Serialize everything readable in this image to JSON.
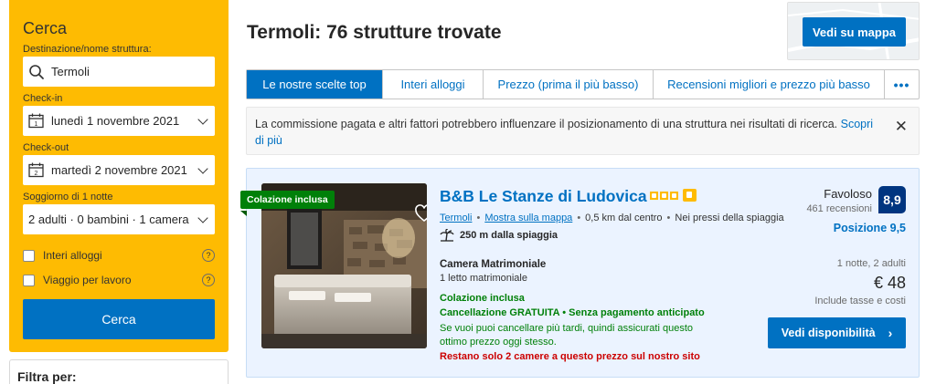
{
  "search": {
    "title": "Cerca",
    "destination_label": "Destinazione/nome struttura:",
    "destination_value": "Termoli",
    "checkin_label": "Check-in",
    "checkin_value": "lunedì 1 novembre 2021",
    "checkout_label": "Check-out",
    "checkout_value": "martedì 2 novembre 2021",
    "stay_label": "Soggiorno di 1 notte",
    "guests_value": "2 adulti · 0 bambini · 1 camera",
    "option_entire": "Interi alloggi",
    "option_business": "Viaggio per lavoro",
    "help_glyph": "?",
    "button": "Cerca"
  },
  "filters": {
    "title": "Filtra per:"
  },
  "header": {
    "title": "Termoli: 76 strutture trovate",
    "map_button": "Vedi su mappa"
  },
  "tabs": [
    {
      "label": "Le nostre scelte top",
      "active": true
    },
    {
      "label": "Interi alloggi"
    },
    {
      "label": "Prezzo (prima il più basso)"
    },
    {
      "label": "Recensioni migliori e prezzo più basso"
    },
    {
      "label": "•••"
    }
  ],
  "notice": {
    "text": "La commissione pagata e altri fattori potrebbero influenzare il posizionamento di una struttura nei risultati di ricerca.",
    "link": "Scopri di più",
    "close": "✕"
  },
  "property": {
    "badge": "Colazione inclusa",
    "name": "B&B Le Stanze di Ludovica",
    "stars": 3,
    "city_link": "Termoli",
    "map_link": "Mostra sulla mappa",
    "distance": "0,5 km dal centro",
    "near": "Nei pressi della spiaggia",
    "beach": "250 m dalla spiaggia",
    "score_word": "Favoloso",
    "reviews": "461 recensioni",
    "score": "8,9",
    "position": "Posizione 9,5",
    "room_name": "Camera Matrimoniale",
    "bed": "1 letto matrimoniale",
    "breakfast": "Colazione inclusa",
    "cancellation": "Cancellazione GRATUITA • Senza pagamento anticipato",
    "cancellation_note": "Se vuoi puoi cancellare più tardi, quindi assicurati questo ottimo prezzo oggi stesso.",
    "scarcity": "Restano solo 2 camere a questo prezzo sul nostro sito",
    "nights": "1 notte, 2 adulti",
    "price": "€ 48",
    "taxes": "Include tasse e costi",
    "button": "Vedi disponibilità",
    "button_arrow": "›"
  },
  "colors": {
    "brand_yellow": "#febb02",
    "primary_blue": "#0071c2",
    "dark_blue": "#003580",
    "green": "#008009",
    "red": "#cc0000"
  }
}
